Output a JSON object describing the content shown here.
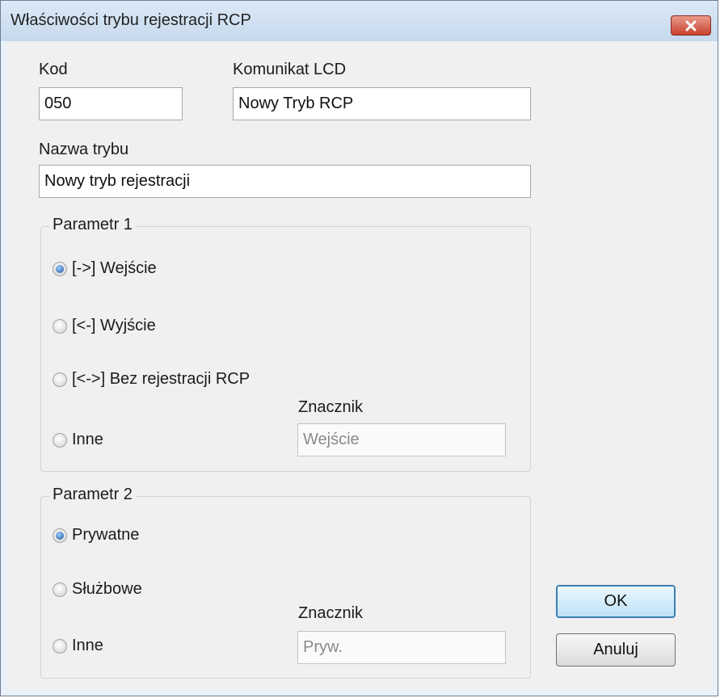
{
  "window": {
    "title": "Właściwości trybu rejestracji RCP"
  },
  "fields": {
    "kod": {
      "label": "Kod",
      "value": "050"
    },
    "komunikat": {
      "label": "Komunikat LCD",
      "value": "Nowy Tryb RCP"
    },
    "nazwa": {
      "label": "Nazwa trybu",
      "value": "Nowy tryb rejestracji"
    }
  },
  "param1": {
    "title": "Parametr 1",
    "options": [
      {
        "label": "[->] Wejście",
        "selected": true
      },
      {
        "label": "[<-] Wyjście",
        "selected": false
      },
      {
        "label": "[<->] Bez rejestracji RCP",
        "selected": false
      },
      {
        "label": "Inne",
        "selected": false
      }
    ],
    "znacznik_label": "Znacznik",
    "znacznik_value": "Wejście"
  },
  "param2": {
    "title": "Parametr 2",
    "options": [
      {
        "label": "Prywatne",
        "selected": true
      },
      {
        "label": "Służbowe",
        "selected": false
      },
      {
        "label": "Inne",
        "selected": false
      }
    ],
    "znacznik_label": "Znacznik",
    "znacznik_value": "Pryw."
  },
  "buttons": {
    "ok": "OK",
    "cancel": "Anuluj"
  },
  "colors": {
    "accent": "#3c7fb1",
    "close": "#c9422f",
    "frame": "#eaf1f8"
  }
}
